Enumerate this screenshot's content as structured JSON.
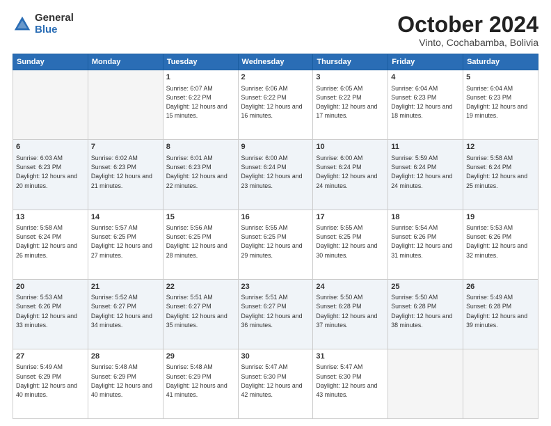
{
  "logo": {
    "general": "General",
    "blue": "Blue"
  },
  "header": {
    "month": "October 2024",
    "location": "Vinto, Cochabamba, Bolivia"
  },
  "weekdays": [
    "Sunday",
    "Monday",
    "Tuesday",
    "Wednesday",
    "Thursday",
    "Friday",
    "Saturday"
  ],
  "weeks": [
    [
      {
        "day": "",
        "info": ""
      },
      {
        "day": "",
        "info": ""
      },
      {
        "day": "1",
        "info": "Sunrise: 6:07 AM\nSunset: 6:22 PM\nDaylight: 12 hours and 15 minutes."
      },
      {
        "day": "2",
        "info": "Sunrise: 6:06 AM\nSunset: 6:22 PM\nDaylight: 12 hours and 16 minutes."
      },
      {
        "day": "3",
        "info": "Sunrise: 6:05 AM\nSunset: 6:22 PM\nDaylight: 12 hours and 17 minutes."
      },
      {
        "day": "4",
        "info": "Sunrise: 6:04 AM\nSunset: 6:23 PM\nDaylight: 12 hours and 18 minutes."
      },
      {
        "day": "5",
        "info": "Sunrise: 6:04 AM\nSunset: 6:23 PM\nDaylight: 12 hours and 19 minutes."
      }
    ],
    [
      {
        "day": "6",
        "info": "Sunrise: 6:03 AM\nSunset: 6:23 PM\nDaylight: 12 hours and 20 minutes."
      },
      {
        "day": "7",
        "info": "Sunrise: 6:02 AM\nSunset: 6:23 PM\nDaylight: 12 hours and 21 minutes."
      },
      {
        "day": "8",
        "info": "Sunrise: 6:01 AM\nSunset: 6:23 PM\nDaylight: 12 hours and 22 minutes."
      },
      {
        "day": "9",
        "info": "Sunrise: 6:00 AM\nSunset: 6:24 PM\nDaylight: 12 hours and 23 minutes."
      },
      {
        "day": "10",
        "info": "Sunrise: 6:00 AM\nSunset: 6:24 PM\nDaylight: 12 hours and 24 minutes."
      },
      {
        "day": "11",
        "info": "Sunrise: 5:59 AM\nSunset: 6:24 PM\nDaylight: 12 hours and 24 minutes."
      },
      {
        "day": "12",
        "info": "Sunrise: 5:58 AM\nSunset: 6:24 PM\nDaylight: 12 hours and 25 minutes."
      }
    ],
    [
      {
        "day": "13",
        "info": "Sunrise: 5:58 AM\nSunset: 6:24 PM\nDaylight: 12 hours and 26 minutes."
      },
      {
        "day": "14",
        "info": "Sunrise: 5:57 AM\nSunset: 6:25 PM\nDaylight: 12 hours and 27 minutes."
      },
      {
        "day": "15",
        "info": "Sunrise: 5:56 AM\nSunset: 6:25 PM\nDaylight: 12 hours and 28 minutes."
      },
      {
        "day": "16",
        "info": "Sunrise: 5:55 AM\nSunset: 6:25 PM\nDaylight: 12 hours and 29 minutes."
      },
      {
        "day": "17",
        "info": "Sunrise: 5:55 AM\nSunset: 6:25 PM\nDaylight: 12 hours and 30 minutes."
      },
      {
        "day": "18",
        "info": "Sunrise: 5:54 AM\nSunset: 6:26 PM\nDaylight: 12 hours and 31 minutes."
      },
      {
        "day": "19",
        "info": "Sunrise: 5:53 AM\nSunset: 6:26 PM\nDaylight: 12 hours and 32 minutes."
      }
    ],
    [
      {
        "day": "20",
        "info": "Sunrise: 5:53 AM\nSunset: 6:26 PM\nDaylight: 12 hours and 33 minutes."
      },
      {
        "day": "21",
        "info": "Sunrise: 5:52 AM\nSunset: 6:27 PM\nDaylight: 12 hours and 34 minutes."
      },
      {
        "day": "22",
        "info": "Sunrise: 5:51 AM\nSunset: 6:27 PM\nDaylight: 12 hours and 35 minutes."
      },
      {
        "day": "23",
        "info": "Sunrise: 5:51 AM\nSunset: 6:27 PM\nDaylight: 12 hours and 36 minutes."
      },
      {
        "day": "24",
        "info": "Sunrise: 5:50 AM\nSunset: 6:28 PM\nDaylight: 12 hours and 37 minutes."
      },
      {
        "day": "25",
        "info": "Sunrise: 5:50 AM\nSunset: 6:28 PM\nDaylight: 12 hours and 38 minutes."
      },
      {
        "day": "26",
        "info": "Sunrise: 5:49 AM\nSunset: 6:28 PM\nDaylight: 12 hours and 39 minutes."
      }
    ],
    [
      {
        "day": "27",
        "info": "Sunrise: 5:49 AM\nSunset: 6:29 PM\nDaylight: 12 hours and 40 minutes."
      },
      {
        "day": "28",
        "info": "Sunrise: 5:48 AM\nSunset: 6:29 PM\nDaylight: 12 hours and 40 minutes."
      },
      {
        "day": "29",
        "info": "Sunrise: 5:48 AM\nSunset: 6:29 PM\nDaylight: 12 hours and 41 minutes."
      },
      {
        "day": "30",
        "info": "Sunrise: 5:47 AM\nSunset: 6:30 PM\nDaylight: 12 hours and 42 minutes."
      },
      {
        "day": "31",
        "info": "Sunrise: 5:47 AM\nSunset: 6:30 PM\nDaylight: 12 hours and 43 minutes."
      },
      {
        "day": "",
        "info": ""
      },
      {
        "day": "",
        "info": ""
      }
    ]
  ]
}
